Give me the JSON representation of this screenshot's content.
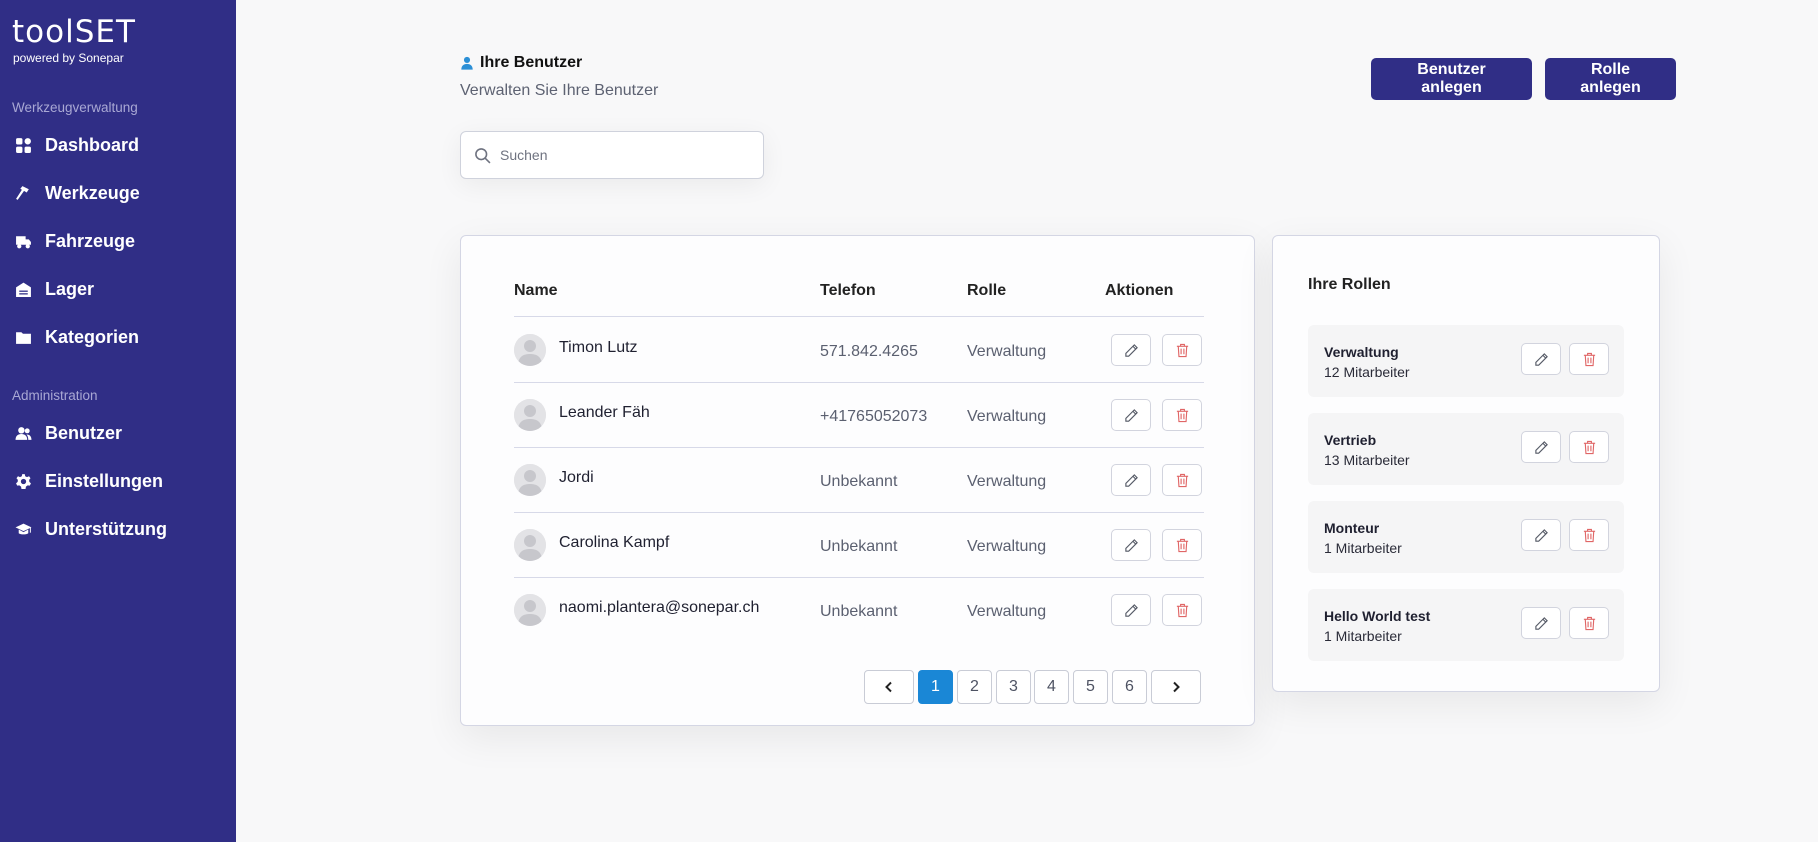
{
  "sidebar": {
    "logo": "toolSET",
    "logo_sub": "powered by Sonepar",
    "section_tools": "Werkzeugverwaltung",
    "section_admin": "Administration",
    "items": [
      {
        "label": "Dashboard",
        "icon": "grid-icon"
      },
      {
        "label": "Werkzeuge",
        "icon": "hammer-icon"
      },
      {
        "label": "Fahrzeuge",
        "icon": "truck-icon"
      },
      {
        "label": "Lager",
        "icon": "warehouse-icon"
      },
      {
        "label": "Kategorien",
        "icon": "folder-icon"
      },
      {
        "label": "Benutzer",
        "icon": "users-icon"
      },
      {
        "label": "Einstellungen",
        "icon": "gear-icon"
      },
      {
        "label": "Unterstützung",
        "icon": "graduation-cap-icon"
      }
    ]
  },
  "header": {
    "title": "Ihre Benutzer",
    "subtitle": "Verwalten Sie Ihre Benutzer",
    "add_user_label": "Benutzer anlegen",
    "add_role_label": "Rolle anlegen"
  },
  "search": {
    "placeholder": "Suchen",
    "value": ""
  },
  "users_table": {
    "columns": [
      "Name",
      "Telefon",
      "Rolle",
      "Aktionen"
    ],
    "rows": [
      {
        "name": "Timon Lutz",
        "phone": "571.842.4265",
        "role": "Verwaltung"
      },
      {
        "name": "Leander Fäh",
        "phone": "+41765052073",
        "role": "Verwaltung"
      },
      {
        "name": "Jordi",
        "phone": "Unbekannt",
        "role": "Verwaltung"
      },
      {
        "name": "Carolina Kampf",
        "phone": "Unbekannt",
        "role": "Verwaltung"
      },
      {
        "name": "naomi.plantera@sonepar.ch",
        "phone": "Unbekannt",
        "role": "Verwaltung"
      }
    ]
  },
  "pagination": {
    "pages": [
      "1",
      "2",
      "3",
      "4",
      "5",
      "6"
    ],
    "current": "1"
  },
  "roles": {
    "title": "Ihre Rollen",
    "items": [
      {
        "name": "Verwaltung",
        "count": "12 Mitarbeiter"
      },
      {
        "name": "Vertrieb",
        "count": "13 Mitarbeiter"
      },
      {
        "name": "Monteur",
        "count": "1 Mitarbeiter"
      },
      {
        "name": "Hello World test",
        "count": "1 Mitarbeiter"
      }
    ]
  },
  "colors": {
    "sidebar": "#302e86",
    "primary_button": "#302e86",
    "active_page": "#1a87d6",
    "delete": "#e06666"
  }
}
